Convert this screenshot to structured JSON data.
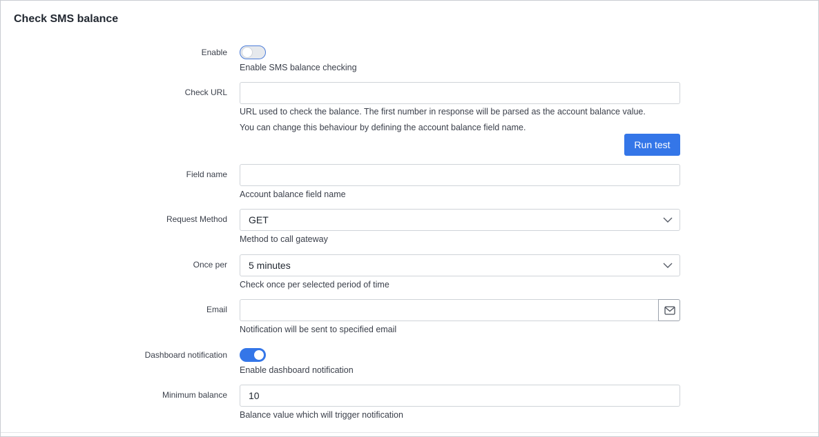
{
  "title": "Check SMS balance",
  "enable": {
    "label": "Enable",
    "state": "off",
    "help": "Enable SMS balance checking"
  },
  "check_url": {
    "label": "Check URL",
    "value": "",
    "help_line1": "URL used to check the balance. The first number in response will be parsed as the account balance value.",
    "help_line2": "You can change this behaviour by defining the account balance field name.",
    "run_test_label": "Run test"
  },
  "field_name": {
    "label": "Field name",
    "value": "",
    "help": "Account balance field name"
  },
  "request_method": {
    "label": "Request Method",
    "value": "GET",
    "help": "Method to call gateway",
    "icon": "chevron-down-icon"
  },
  "once_per": {
    "label": "Once per",
    "value": "5 minutes",
    "help": "Check once per selected period of time",
    "icon": "chevron-down-icon"
  },
  "email": {
    "label": "Email",
    "value": "",
    "help": "Notification will be sent to specified email",
    "icon": "envelope-icon"
  },
  "dashboard_notification": {
    "label": "Dashboard notification",
    "state": "on",
    "help": "Enable dashboard notification"
  },
  "minimum_balance": {
    "label": "Minimum balance",
    "value": "10",
    "help": "Balance value which will trigger notification"
  },
  "colors": {
    "accent": "#3476e8",
    "border": "#cfd3d8",
    "text": "#3a3f4a",
    "title": "#222831"
  }
}
